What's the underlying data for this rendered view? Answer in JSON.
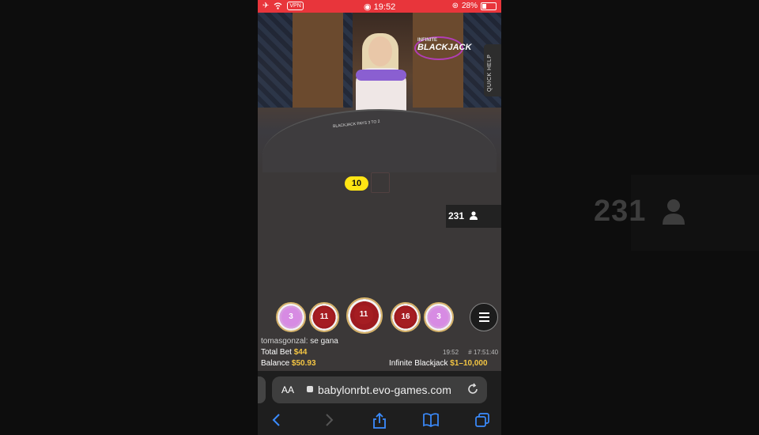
{
  "status_bar": {
    "time": "19:52",
    "vpn": "VPN",
    "battery": "28%"
  },
  "video": {
    "game_logo_small": "INFINITE",
    "game_logo_big": "BLACKJACK",
    "table_text": "BLACKJACK PAYS 3 TO 2",
    "quick_help": "QUICK HELP"
  },
  "score": "10",
  "viewers": {
    "count": "231"
  },
  "side_viewers": {
    "count": "231"
  },
  "chips": [
    {
      "value": "3",
      "color": "pink"
    },
    {
      "value": "11",
      "color": "red"
    },
    {
      "value": "11",
      "color": "red",
      "selected": true
    },
    {
      "value": "16",
      "color": "red"
    },
    {
      "value": "3",
      "color": "pink"
    }
  ],
  "chat": {
    "user": "tomasgonzal:",
    "message": "se gana"
  },
  "total_bet": {
    "label": "Total Bet",
    "value": "$44"
  },
  "balance": {
    "label": "Balance",
    "value": "$50.93"
  },
  "round": {
    "time": "19:52",
    "id": "# 17:51:40"
  },
  "table_info": {
    "name": "Infinite Blackjack",
    "limits": "$1–10,000"
  },
  "safari": {
    "aa": "AA",
    "url": "babylonrbt.evo-games.com"
  },
  "colors": {
    "status_red": "#e8353b",
    "score_yellow": "#ffe514",
    "gold": "#f3c543"
  }
}
